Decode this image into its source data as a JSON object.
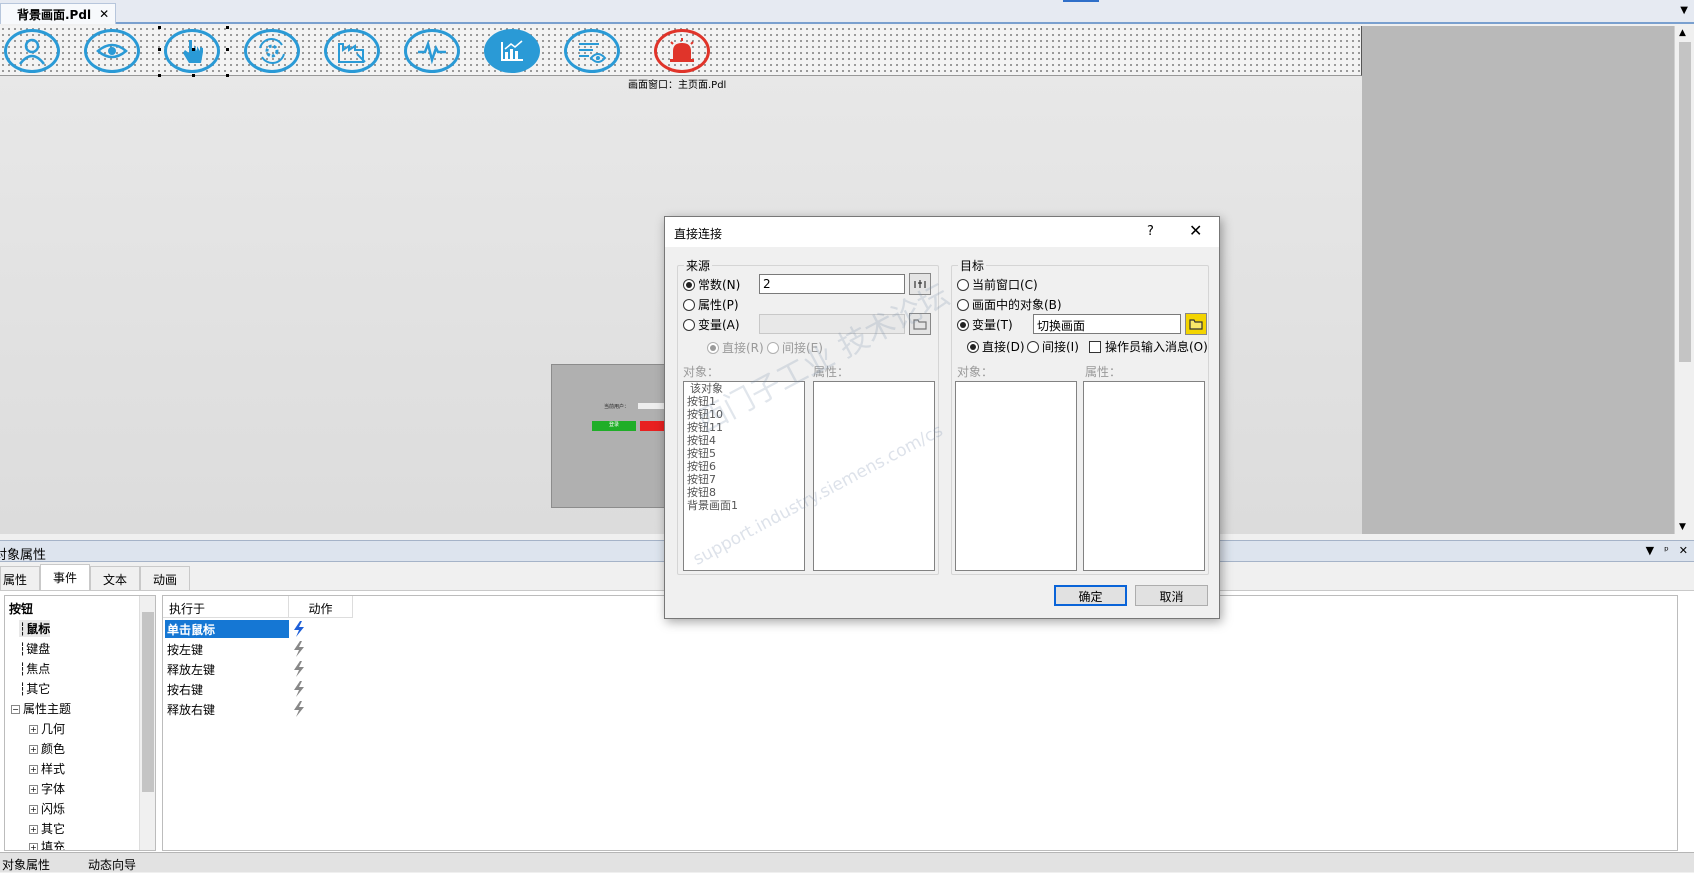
{
  "document_tab": {
    "title": "背景画面.Pdl",
    "close": "✕"
  },
  "tabbar_menu": "▼",
  "canvas": {
    "frame_label": "画面窗口：主页面.Pdl",
    "toolbar_icons": [
      "user-icon",
      "eye-icon",
      "hand-pointer-icon",
      "gear-cycle-icon",
      "factory-icon",
      "pulse-icon",
      "chart-icon",
      "settings-eye-icon",
      "alarm-bell-icon"
    ],
    "login_preview": {
      "user_label": "当前用户：",
      "login_button": "登录"
    }
  },
  "colors": {
    "accent_blue": "#2a9ad6",
    "alarm_red": "#e0342a",
    "selection_blue": "#1577d4"
  },
  "dialog": {
    "title": "直接连接",
    "help": "?",
    "close": "✕",
    "source": {
      "legend": "来源",
      "constant_label": "常数(N)",
      "constant_value": "2",
      "property_label": "属性(P)",
      "variable_label": "变量(A)",
      "direct_label": "直接(R)",
      "indirect_label": "间接(E)",
      "object_header": "对象：",
      "property_header": "属性：",
      "objects": [
        "该对象",
        "按钮1",
        "按钮10",
        "按钮11",
        "按钮4",
        "按钮5",
        "按钮6",
        "按钮7",
        "按钮8",
        "背景画面1"
      ]
    },
    "target": {
      "legend": "目标",
      "current_window_label": "当前窗口(C)",
      "object_in_picture_label": "画面中的对象(B)",
      "variable_label": "变量(T)",
      "variable_value": "切换画面",
      "direct_label": "直接(D)",
      "indirect_label": "间接(I)",
      "operator_msg_label": "操作员输入消息(O)",
      "object_header": "对象：",
      "property_header": "属性："
    },
    "ok": "确定",
    "cancel": "取消",
    "watermark_line1": "西门子工业 技术论坛",
    "watermark_line2": "support.industry.siemens.com/cs"
  },
  "properties_panel": {
    "title": "对象属性",
    "header_icons": [
      "▼",
      "ᵖ",
      "✕"
    ],
    "tabs": [
      "属性",
      "事件",
      "文本",
      "动画"
    ],
    "active_tab": "事件",
    "tree": {
      "root": "按钮",
      "items": [
        {
          "label": "鼠标",
          "level": 1,
          "bold": true
        },
        {
          "label": "键盘",
          "level": 1
        },
        {
          "label": "焦点",
          "level": 1
        },
        {
          "label": "其它",
          "level": 1
        },
        {
          "label": "属性主题",
          "level": 0,
          "expand": "−"
        },
        {
          "label": "几何",
          "level": 2,
          "expand": "+"
        },
        {
          "label": "颜色",
          "level": 2,
          "expand": "+"
        },
        {
          "label": "样式",
          "level": 2,
          "expand": "+"
        },
        {
          "label": "字体",
          "level": 2,
          "expand": "+"
        },
        {
          "label": "闪烁",
          "level": 2,
          "expand": "+"
        },
        {
          "label": "其它",
          "level": 2,
          "expand": "+"
        },
        {
          "label": "填充",
          "level": 2,
          "expand": "+"
        }
      ]
    },
    "events_table": {
      "headers": [
        "执行于",
        "动作"
      ],
      "rows": [
        {
          "label": "单击鼠标",
          "selected": true
        },
        {
          "label": "按左键"
        },
        {
          "label": "释放左键"
        },
        {
          "label": "按右键"
        },
        {
          "label": "释放右键"
        }
      ]
    }
  },
  "bottom_tabs": [
    "对象属性",
    "动态向导"
  ]
}
